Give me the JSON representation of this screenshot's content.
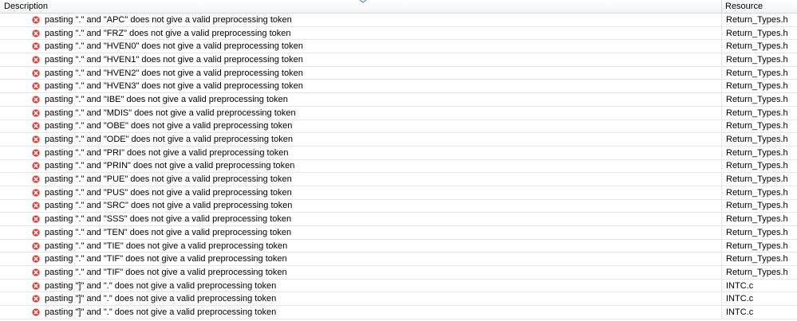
{
  "columns": {
    "description": "Description",
    "resource": "Resource"
  },
  "icons": {
    "row": "error-icon",
    "error_color": "#e53935"
  },
  "rows": [
    {
      "description": "pasting \".\" and \"APC\" does not give a valid preprocessing token",
      "resource": "Return_Types.h"
    },
    {
      "description": "pasting \".\" and \"FRZ\" does not give a valid preprocessing token",
      "resource": "Return_Types.h"
    },
    {
      "description": "pasting \".\" and \"HVEN0\" does not give a valid preprocessing token",
      "resource": "Return_Types.h"
    },
    {
      "description": "pasting \".\" and \"HVEN1\" does not give a valid preprocessing token",
      "resource": "Return_Types.h"
    },
    {
      "description": "pasting \".\" and \"HVEN2\" does not give a valid preprocessing token",
      "resource": "Return_Types.h"
    },
    {
      "description": "pasting \".\" and \"HVEN3\" does not give a valid preprocessing token",
      "resource": "Return_Types.h"
    },
    {
      "description": "pasting \".\" and \"IBE\" does not give a valid preprocessing token",
      "resource": "Return_Types.h"
    },
    {
      "description": "pasting \".\" and \"MDIS\" does not give a valid preprocessing token",
      "resource": "Return_Types.h"
    },
    {
      "description": "pasting \".\" and \"OBE\" does not give a valid preprocessing token",
      "resource": "Return_Types.h"
    },
    {
      "description": "pasting \".\" and \"ODE\" does not give a valid preprocessing token",
      "resource": "Return_Types.h"
    },
    {
      "description": "pasting \".\" and \"PRI\" does not give a valid preprocessing token",
      "resource": "Return_Types.h"
    },
    {
      "description": "pasting \".\" and \"PRIN\" does not give a valid preprocessing token",
      "resource": "Return_Types.h"
    },
    {
      "description": "pasting \".\" and \"PUE\" does not give a valid preprocessing token",
      "resource": "Return_Types.h"
    },
    {
      "description": "pasting \".\" and \"PUS\" does not give a valid preprocessing token",
      "resource": "Return_Types.h"
    },
    {
      "description": "pasting \".\" and \"SRC\" does not give a valid preprocessing token",
      "resource": "Return_Types.h"
    },
    {
      "description": "pasting \".\" and \"SSS\" does not give a valid preprocessing token",
      "resource": "Return_Types.h"
    },
    {
      "description": "pasting \".\" and \"TEN\" does not give a valid preprocessing token",
      "resource": "Return_Types.h"
    },
    {
      "description": "pasting \".\" and \"TIE\" does not give a valid preprocessing token",
      "resource": "Return_Types.h"
    },
    {
      "description": "pasting \".\" and \"TIF\" does not give a valid preprocessing token",
      "resource": "Return_Types.h"
    },
    {
      "description": "pasting \".\" and \"TIF\" does not give a valid preprocessing token",
      "resource": "Return_Types.h"
    },
    {
      "description": "pasting \"]\" and \".\" does not give a valid preprocessing token",
      "resource": "INTC.c"
    },
    {
      "description": "pasting \"]\" and \".\" does not give a valid preprocessing token",
      "resource": "INTC.c"
    },
    {
      "description": "pasting \"]\" and \".\" does not give a valid preprocessing token",
      "resource": "INTC.c"
    }
  ]
}
